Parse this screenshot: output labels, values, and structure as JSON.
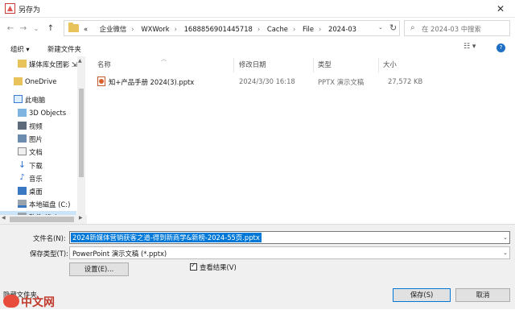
{
  "window": {
    "title": "另存为",
    "close_glyph": "✕"
  },
  "nav": {
    "back": "←",
    "forward": "→",
    "recent": "⌄",
    "up": "↑"
  },
  "breadcrumb": [
    "«",
    "企业微信",
    "WXWork",
    "1688856901445718",
    "Cache",
    "File",
    "2024-03"
  ],
  "search": {
    "placeholder": "在 2024-03 中搜索"
  },
  "toolbar": {
    "organize": "组织 ▾",
    "new_folder": "新建文件夹",
    "view_glyph": "☷ ▾",
    "help_glyph": "?"
  },
  "sidebar": {
    "items": [
      {
        "label": "媒体库女团影 ⇲"
      },
      {
        "label": "OneDrive"
      },
      {
        "label": "此电脑"
      },
      {
        "label": "3D Objects"
      },
      {
        "label": "视频"
      },
      {
        "label": "图片"
      },
      {
        "label": "文档"
      },
      {
        "label": "下载"
      },
      {
        "label": "音乐"
      },
      {
        "label": "桌面"
      },
      {
        "label": "本地磁盘 (C:)"
      },
      {
        "label": "软件 (D:)"
      }
    ]
  },
  "columns": {
    "name": "名称",
    "modified": "修改日期",
    "type": "类型",
    "size": "大小"
  },
  "files": [
    {
      "name": "知+产品手册 2024(3).pptx",
      "modified": "2024/3/30 16:18",
      "type": "PPTX 演示文稿",
      "size": "27,572 KB"
    }
  ],
  "form": {
    "filename_label": "文件名(N):",
    "filename_value": "2024新媒体营销获客之道-得到新商学&新榜-2024-55页.pptx",
    "filetype_label": "保存类型(T):",
    "filetype_value": "PowerPoint 演示文稿 (*.pptx)",
    "settings_button": "设置(E)...",
    "view_results_label": "查看结果(V)",
    "view_results_checked": true,
    "hide_folders": "隐藏文件夹",
    "save_button": "保存(S)",
    "cancel_button": "取消"
  },
  "watermark": {
    "text": "中文网"
  },
  "colors": {
    "accent": "#0078d7",
    "selection": "#cce4f7",
    "folder": "#e8c25a"
  }
}
